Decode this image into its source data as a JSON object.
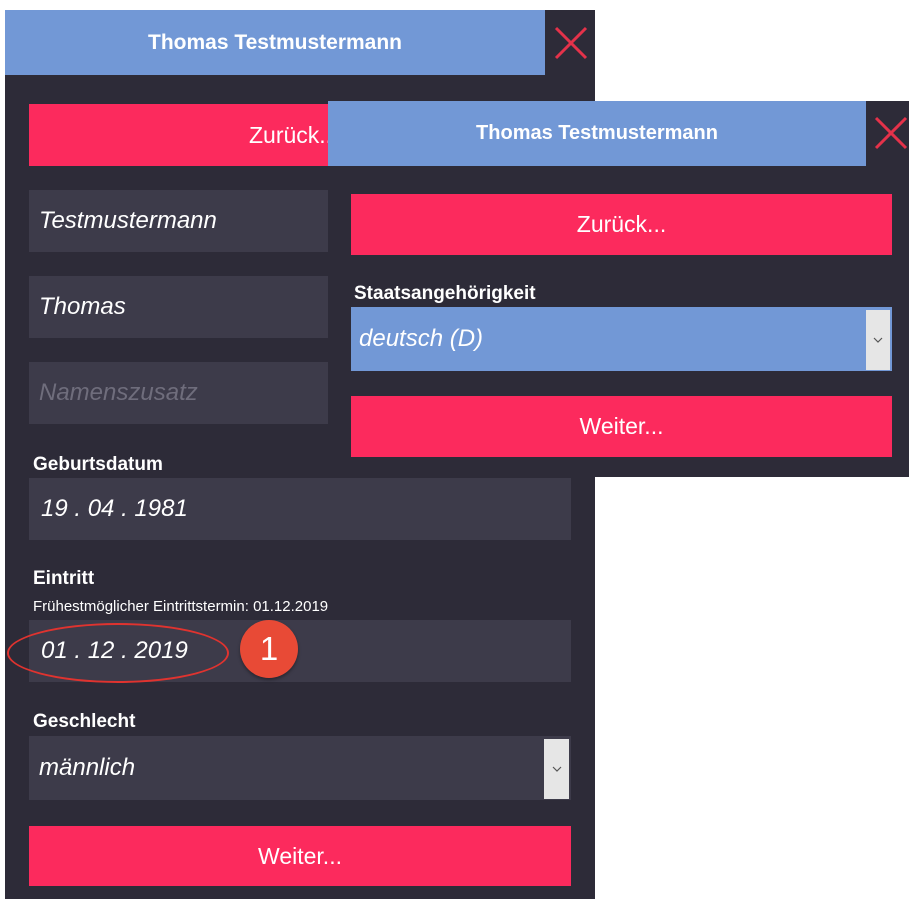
{
  "back_window": {
    "title": "Thomas Testmustermann",
    "close_icon": "close-x-icon",
    "back_button": "Zurück...",
    "last_name": "Testmustermann",
    "first_name": "Thomas",
    "name_suffix_placeholder": "Namenszusatz",
    "birthdate_label": "Geburtsdatum",
    "birthdate_value": "19 . 04 . 1981",
    "entry_label": "Eintritt",
    "entry_hint": "Frühestmöglicher Eintrittstermin: 01.12.2019",
    "entry_value": "01 . 12 . 2019",
    "gender_label": "Geschlecht",
    "gender_value": "männlich",
    "next_button": "Weiter..."
  },
  "front_window": {
    "title": "Thomas Testmustermann",
    "close_icon": "close-x-icon",
    "back_button": "Zurück...",
    "nationality_label": "Staatsangehörigkeit",
    "nationality_value": "deutsch (D)",
    "next_button": "Weiter..."
  },
  "annotation": {
    "badge_number": "1"
  },
  "colors": {
    "panel_bg": "#2d2b38",
    "field_bg": "#3d3b4a",
    "titlebar": "#7298d6",
    "accent_button": "#fc2a5d",
    "close_x": "#e4324a",
    "annotation": "#e84a36"
  }
}
